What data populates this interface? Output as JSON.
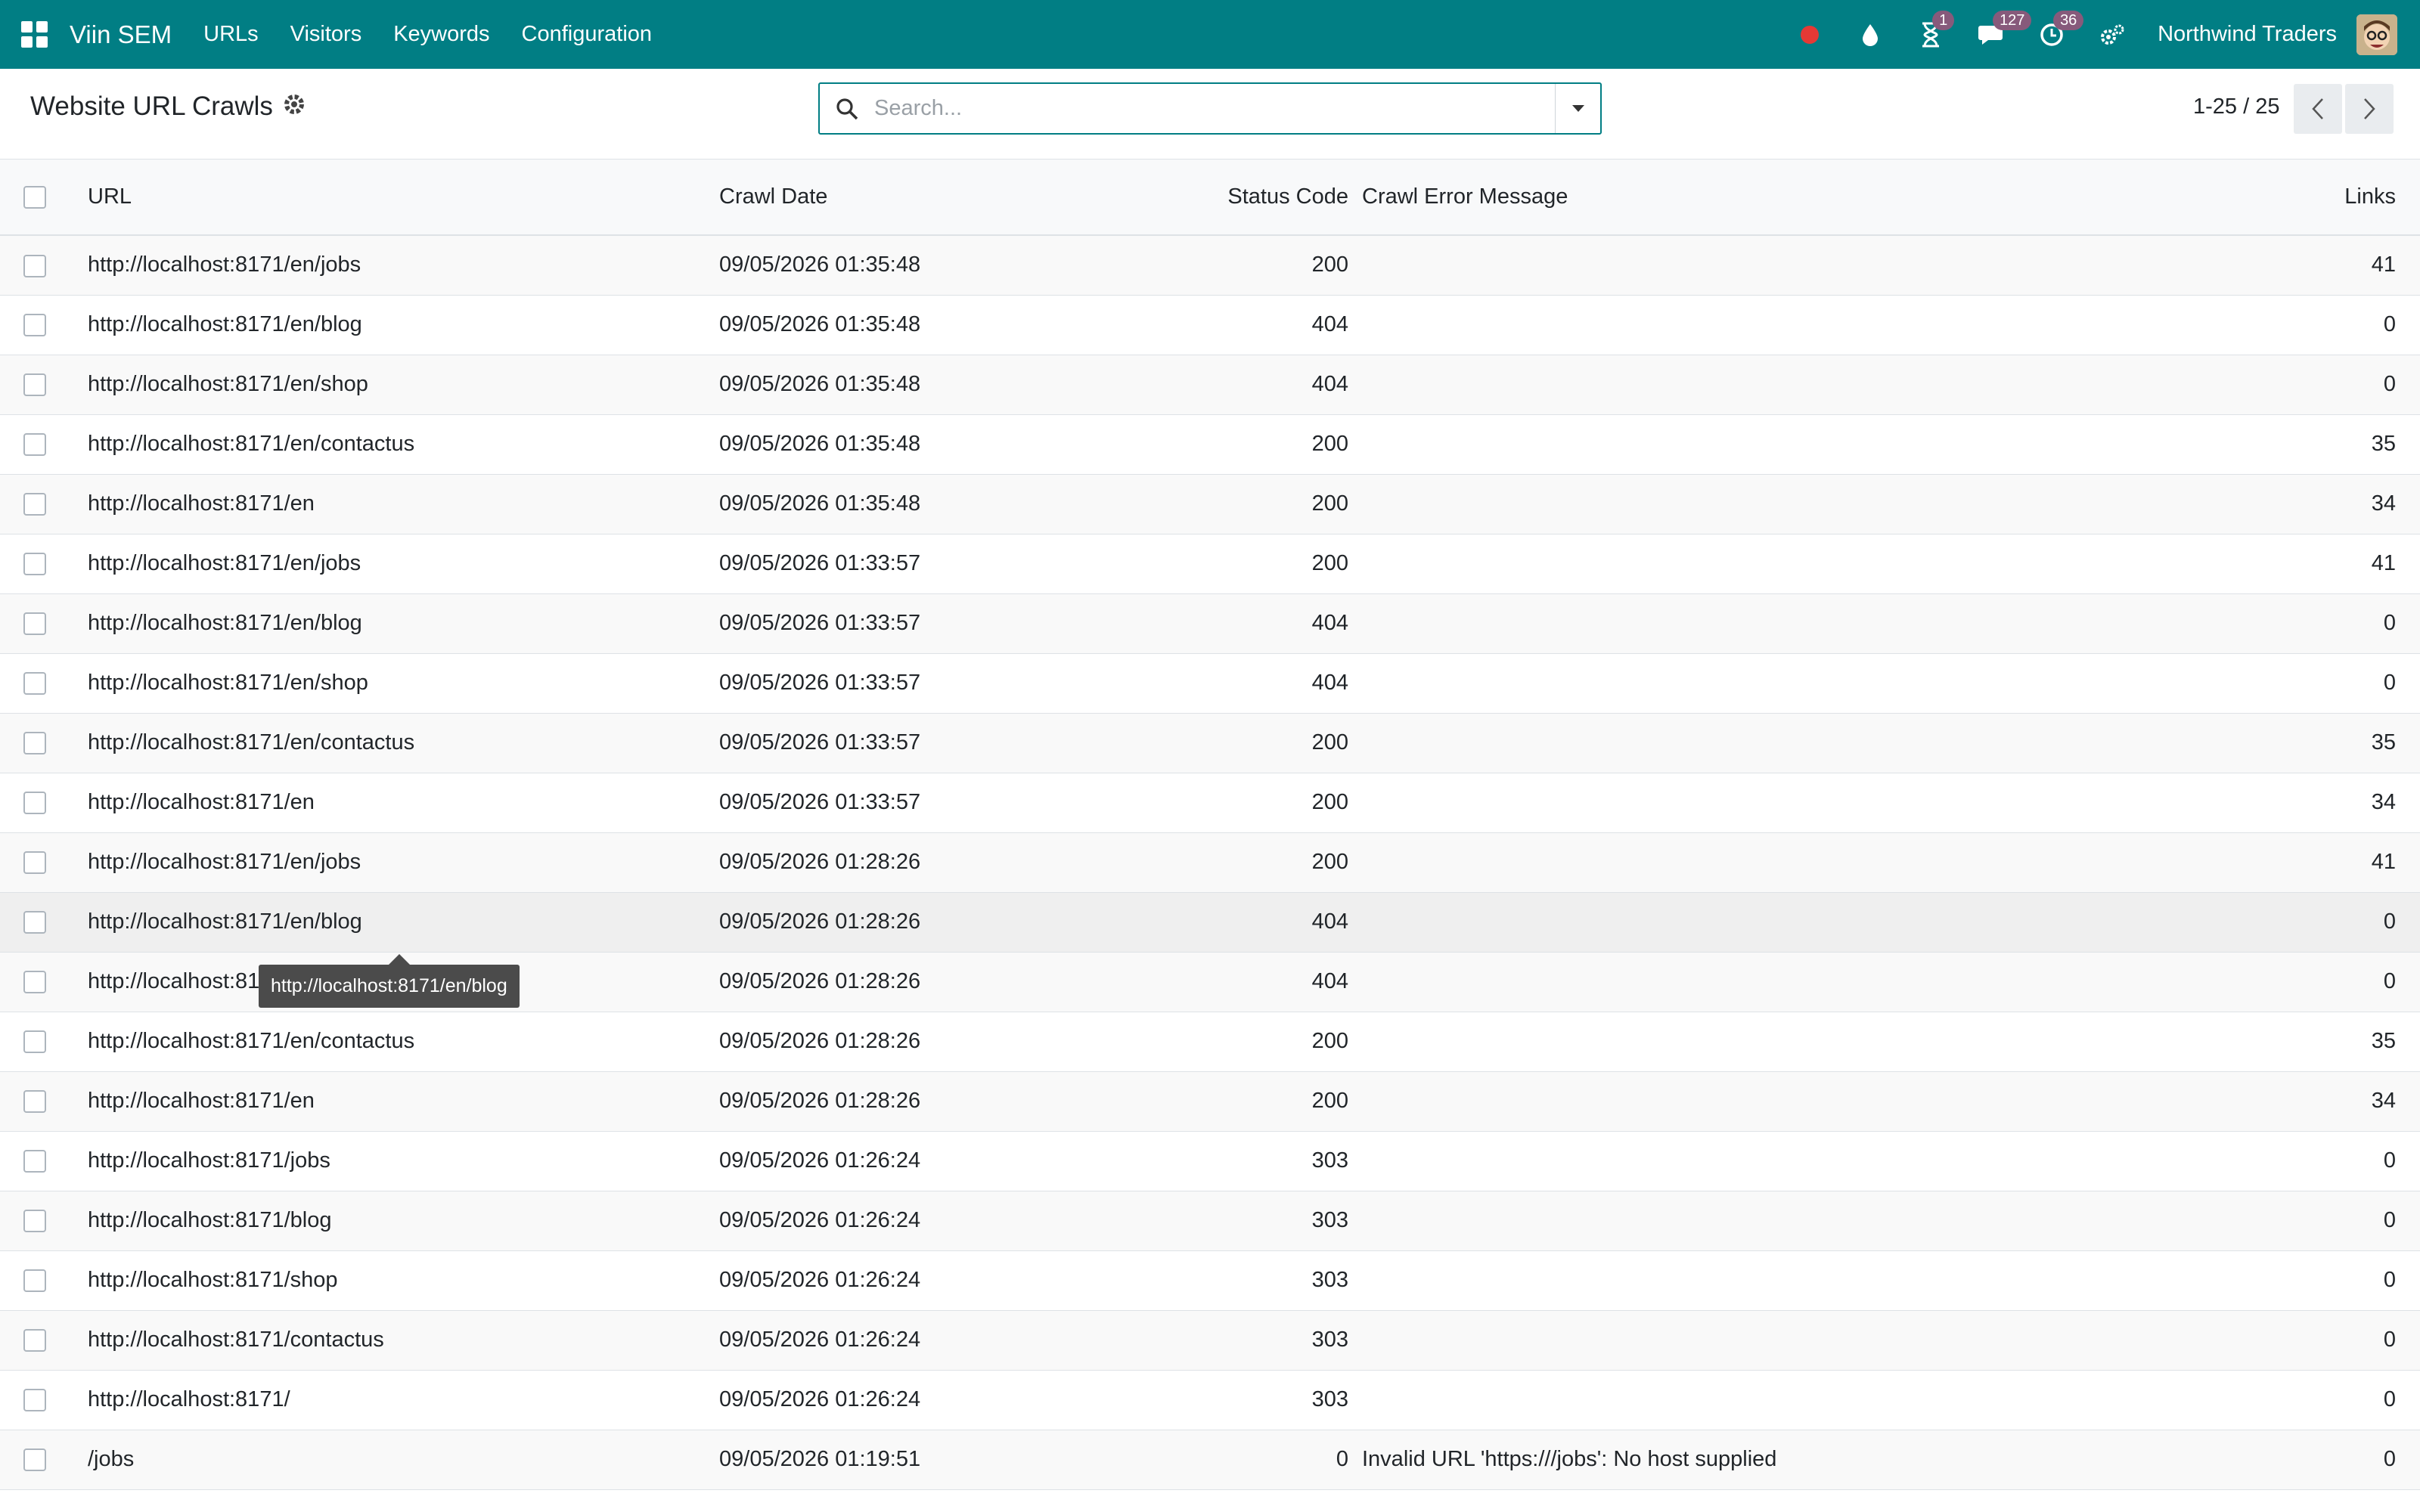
{
  "navbar": {
    "brand": "Viin SEM",
    "menu": [
      "URLs",
      "Visitors",
      "Keywords",
      "Configuration"
    ],
    "activities_badge": "1",
    "messages_badge": "127",
    "timer_badge": "36",
    "company": "Northwind Traders",
    "accent_color": "#017e84",
    "record_color": "#e53935"
  },
  "control_panel": {
    "title": "Website URL Crawls",
    "search_placeholder": "Search...",
    "pager": "1-25 / 25"
  },
  "table": {
    "columns": [
      "URL",
      "Crawl Date",
      "Status Code",
      "Crawl Error Message",
      "Links"
    ],
    "rows": [
      {
        "url": "http://localhost:8171/en/jobs",
        "date": "09/05/2026 01:35:48",
        "status": "200",
        "error": "",
        "links": "41"
      },
      {
        "url": "http://localhost:8171/en/blog",
        "date": "09/05/2026 01:35:48",
        "status": "404",
        "error": "",
        "links": "0"
      },
      {
        "url": "http://localhost:8171/en/shop",
        "date": "09/05/2026 01:35:48",
        "status": "404",
        "error": "",
        "links": "0"
      },
      {
        "url": "http://localhost:8171/en/contactus",
        "date": "09/05/2026 01:35:48",
        "status": "200",
        "error": "",
        "links": "35"
      },
      {
        "url": "http://localhost:8171/en",
        "date": "09/05/2026 01:35:48",
        "status": "200",
        "error": "",
        "links": "34"
      },
      {
        "url": "http://localhost:8171/en/jobs",
        "date": "09/05/2026 01:33:57",
        "status": "200",
        "error": "",
        "links": "41"
      },
      {
        "url": "http://localhost:8171/en/blog",
        "date": "09/05/2026 01:33:57",
        "status": "404",
        "error": "",
        "links": "0"
      },
      {
        "url": "http://localhost:8171/en/shop",
        "date": "09/05/2026 01:33:57",
        "status": "404",
        "error": "",
        "links": "0"
      },
      {
        "url": "http://localhost:8171/en/contactus",
        "date": "09/05/2026 01:33:57",
        "status": "200",
        "error": "",
        "links": "35"
      },
      {
        "url": "http://localhost:8171/en",
        "date": "09/05/2026 01:33:57",
        "status": "200",
        "error": "",
        "links": "34"
      },
      {
        "url": "http://localhost:8171/en/jobs",
        "date": "09/05/2026 01:28:26",
        "status": "200",
        "error": "",
        "links": "41"
      },
      {
        "url": "http://localhost:8171/en/blog",
        "date": "09/05/2026 01:28:26",
        "status": "404",
        "error": "",
        "links": "0"
      },
      {
        "url": "http://localhost:8171/en/shop",
        "date": "09/05/2026 01:28:26",
        "status": "404",
        "error": "",
        "links": "0"
      },
      {
        "url": "http://localhost:8171/en/contactus",
        "date": "09/05/2026 01:28:26",
        "status": "200",
        "error": "",
        "links": "35"
      },
      {
        "url": "http://localhost:8171/en",
        "date": "09/05/2026 01:28:26",
        "status": "200",
        "error": "",
        "links": "34"
      },
      {
        "url": "http://localhost:8171/jobs",
        "date": "09/05/2026 01:26:24",
        "status": "303",
        "error": "",
        "links": "0"
      },
      {
        "url": "http://localhost:8171/blog",
        "date": "09/05/2026 01:26:24",
        "status": "303",
        "error": "",
        "links": "0"
      },
      {
        "url": "http://localhost:8171/shop",
        "date": "09/05/2026 01:26:24",
        "status": "303",
        "error": "",
        "links": "0"
      },
      {
        "url": "http://localhost:8171/contactus",
        "date": "09/05/2026 01:26:24",
        "status": "303",
        "error": "",
        "links": "0"
      },
      {
        "url": "http://localhost:8171/",
        "date": "09/05/2026 01:26:24",
        "status": "303",
        "error": "",
        "links": "0"
      },
      {
        "url": "/jobs",
        "date": "09/05/2026 01:19:51",
        "status": "0",
        "error": "Invalid URL 'https:///jobs': No host supplied",
        "links": "0"
      }
    ]
  },
  "tooltip": {
    "text": "http://localhost:8171/en/blog"
  }
}
